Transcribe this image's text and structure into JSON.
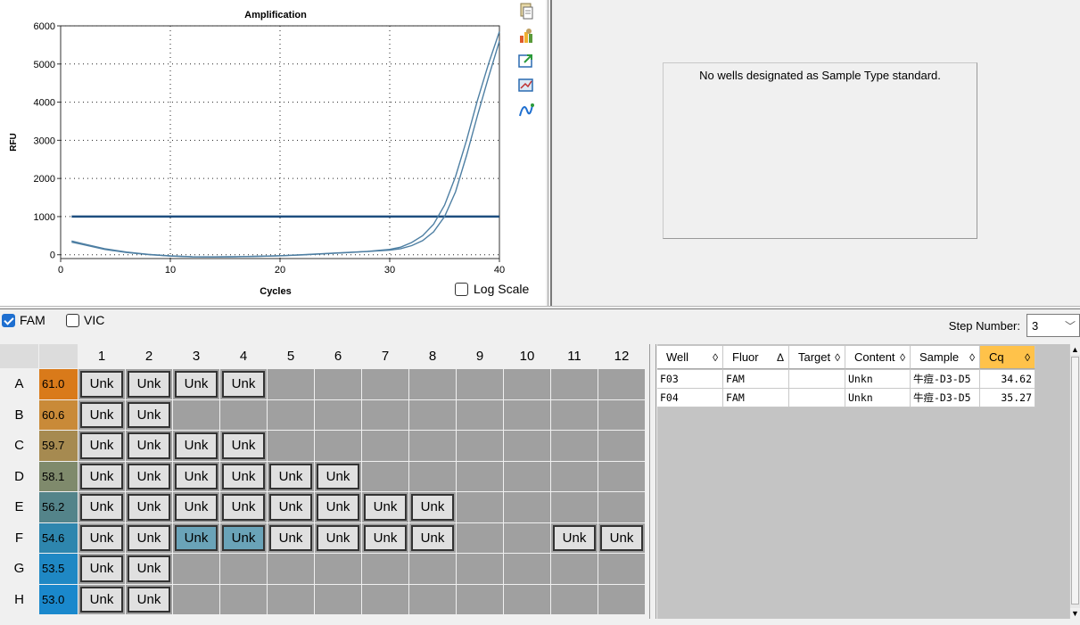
{
  "chart": {
    "title": "Amplification",
    "xlabel": "Cycles",
    "ylabel": "RFU",
    "log_scale_label": "Log Scale",
    "log_scale_checked": false
  },
  "chart_data": {
    "type": "line",
    "title": "Amplification",
    "xlabel": "Cycles",
    "ylabel": "RFU",
    "xlim": [
      0,
      40
    ],
    "ylim": [
      -100,
      6000
    ],
    "x_ticks": [
      0,
      10,
      20,
      30,
      40
    ],
    "y_ticks": [
      0,
      1000,
      2000,
      3000,
      4000,
      5000,
      6000
    ],
    "grid": "dotted",
    "threshold": 1000,
    "series": [
      {
        "x": [
          1,
          2,
          4,
          6,
          8,
          10,
          12,
          14,
          16,
          18,
          20,
          22,
          24,
          26,
          28,
          30,
          31,
          32,
          33,
          34,
          35,
          36,
          37,
          38,
          39,
          40
        ],
        "values": [
          360,
          290,
          160,
          70,
          10,
          -30,
          -50,
          -55,
          -50,
          -40,
          -25,
          0,
          30,
          60,
          90,
          140,
          200,
          320,
          500,
          800,
          1300,
          2050,
          3000,
          4050,
          5000,
          5850
        ],
        "color": "#4e7fa3"
      },
      {
        "x": [
          1,
          2,
          4,
          6,
          8,
          10,
          12,
          14,
          16,
          18,
          20,
          22,
          24,
          26,
          28,
          30,
          31,
          32,
          33,
          34,
          35,
          36,
          37,
          38,
          39,
          40
        ],
        "values": [
          330,
          270,
          140,
          60,
          5,
          -35,
          -55,
          -58,
          -52,
          -42,
          -28,
          -5,
          25,
          55,
          85,
          120,
          160,
          240,
          370,
          600,
          1000,
          1650,
          2600,
          3650,
          4650,
          5600
        ],
        "color": "#4e7fa3"
      }
    ]
  },
  "tools": {
    "icons": [
      "copy-icon",
      "chart-settings-icon",
      "export-icon",
      "zoom-icon",
      "trace-icon"
    ]
  },
  "standard_panel": {
    "message": "No wells designated as Sample Type standard."
  },
  "fluor_bar": {
    "fam_label": "FAM",
    "fam_checked": true,
    "vic_label": "VIC",
    "vic_checked": false,
    "step_label": "Step Number:",
    "step_value": "3"
  },
  "plate": {
    "columns": [
      "1",
      "2",
      "3",
      "4",
      "5",
      "6",
      "7",
      "8",
      "9",
      "10",
      "11",
      "12"
    ],
    "rows": [
      {
        "label": "A",
        "temp": "61.0",
        "color": "#d97a1a",
        "wells": [
          1,
          2,
          3,
          4
        ]
      },
      {
        "label": "B",
        "temp": "60.6",
        "color": "#c98a38",
        "wells": [
          1,
          2
        ]
      },
      {
        "label": "C",
        "temp": "59.7",
        "color": "#a68a50",
        "wells": [
          1,
          2,
          3,
          4
        ]
      },
      {
        "label": "D",
        "temp": "58.1",
        "color": "#7f8a6c",
        "wells": [
          1,
          2,
          3,
          4,
          5,
          6
        ]
      },
      {
        "label": "E",
        "temp": "56.2",
        "color": "#54848a",
        "wells": [
          1,
          2,
          3,
          4,
          5,
          6,
          7,
          8
        ]
      },
      {
        "label": "F",
        "temp": "54.6",
        "color": "#2e86ae",
        "wells": [
          1,
          2,
          3,
          4,
          5,
          6,
          7,
          8,
          11,
          12
        ]
      },
      {
        "label": "G",
        "temp": "53.5",
        "color": "#1f88c4",
        "wells": [
          1,
          2
        ]
      },
      {
        "label": "H",
        "temp": "53.0",
        "color": "#1a88cc",
        "wells": [
          1,
          2
        ]
      }
    ],
    "well_label": "Unk",
    "selected": [
      "F3",
      "F4"
    ]
  },
  "results": {
    "headers": [
      {
        "label": "Well",
        "sort": "◊"
      },
      {
        "label": "Fluor",
        "sort": "Δ"
      },
      {
        "label": "Target",
        "sort": "◊"
      },
      {
        "label": "Content",
        "sort": "◊"
      },
      {
        "label": "Sample",
        "sort": "◊"
      },
      {
        "label": "Cq",
        "sort": "◊"
      }
    ],
    "rows": [
      {
        "well": "F03",
        "fluor": "FAM",
        "target": "",
        "content": "Unkn",
        "sample": "牛痘-D3-D5",
        "cq": "34.62"
      },
      {
        "well": "F04",
        "fluor": "FAM",
        "target": "",
        "content": "Unkn",
        "sample": "牛痘-D3-D5",
        "cq": "35.27"
      }
    ]
  }
}
